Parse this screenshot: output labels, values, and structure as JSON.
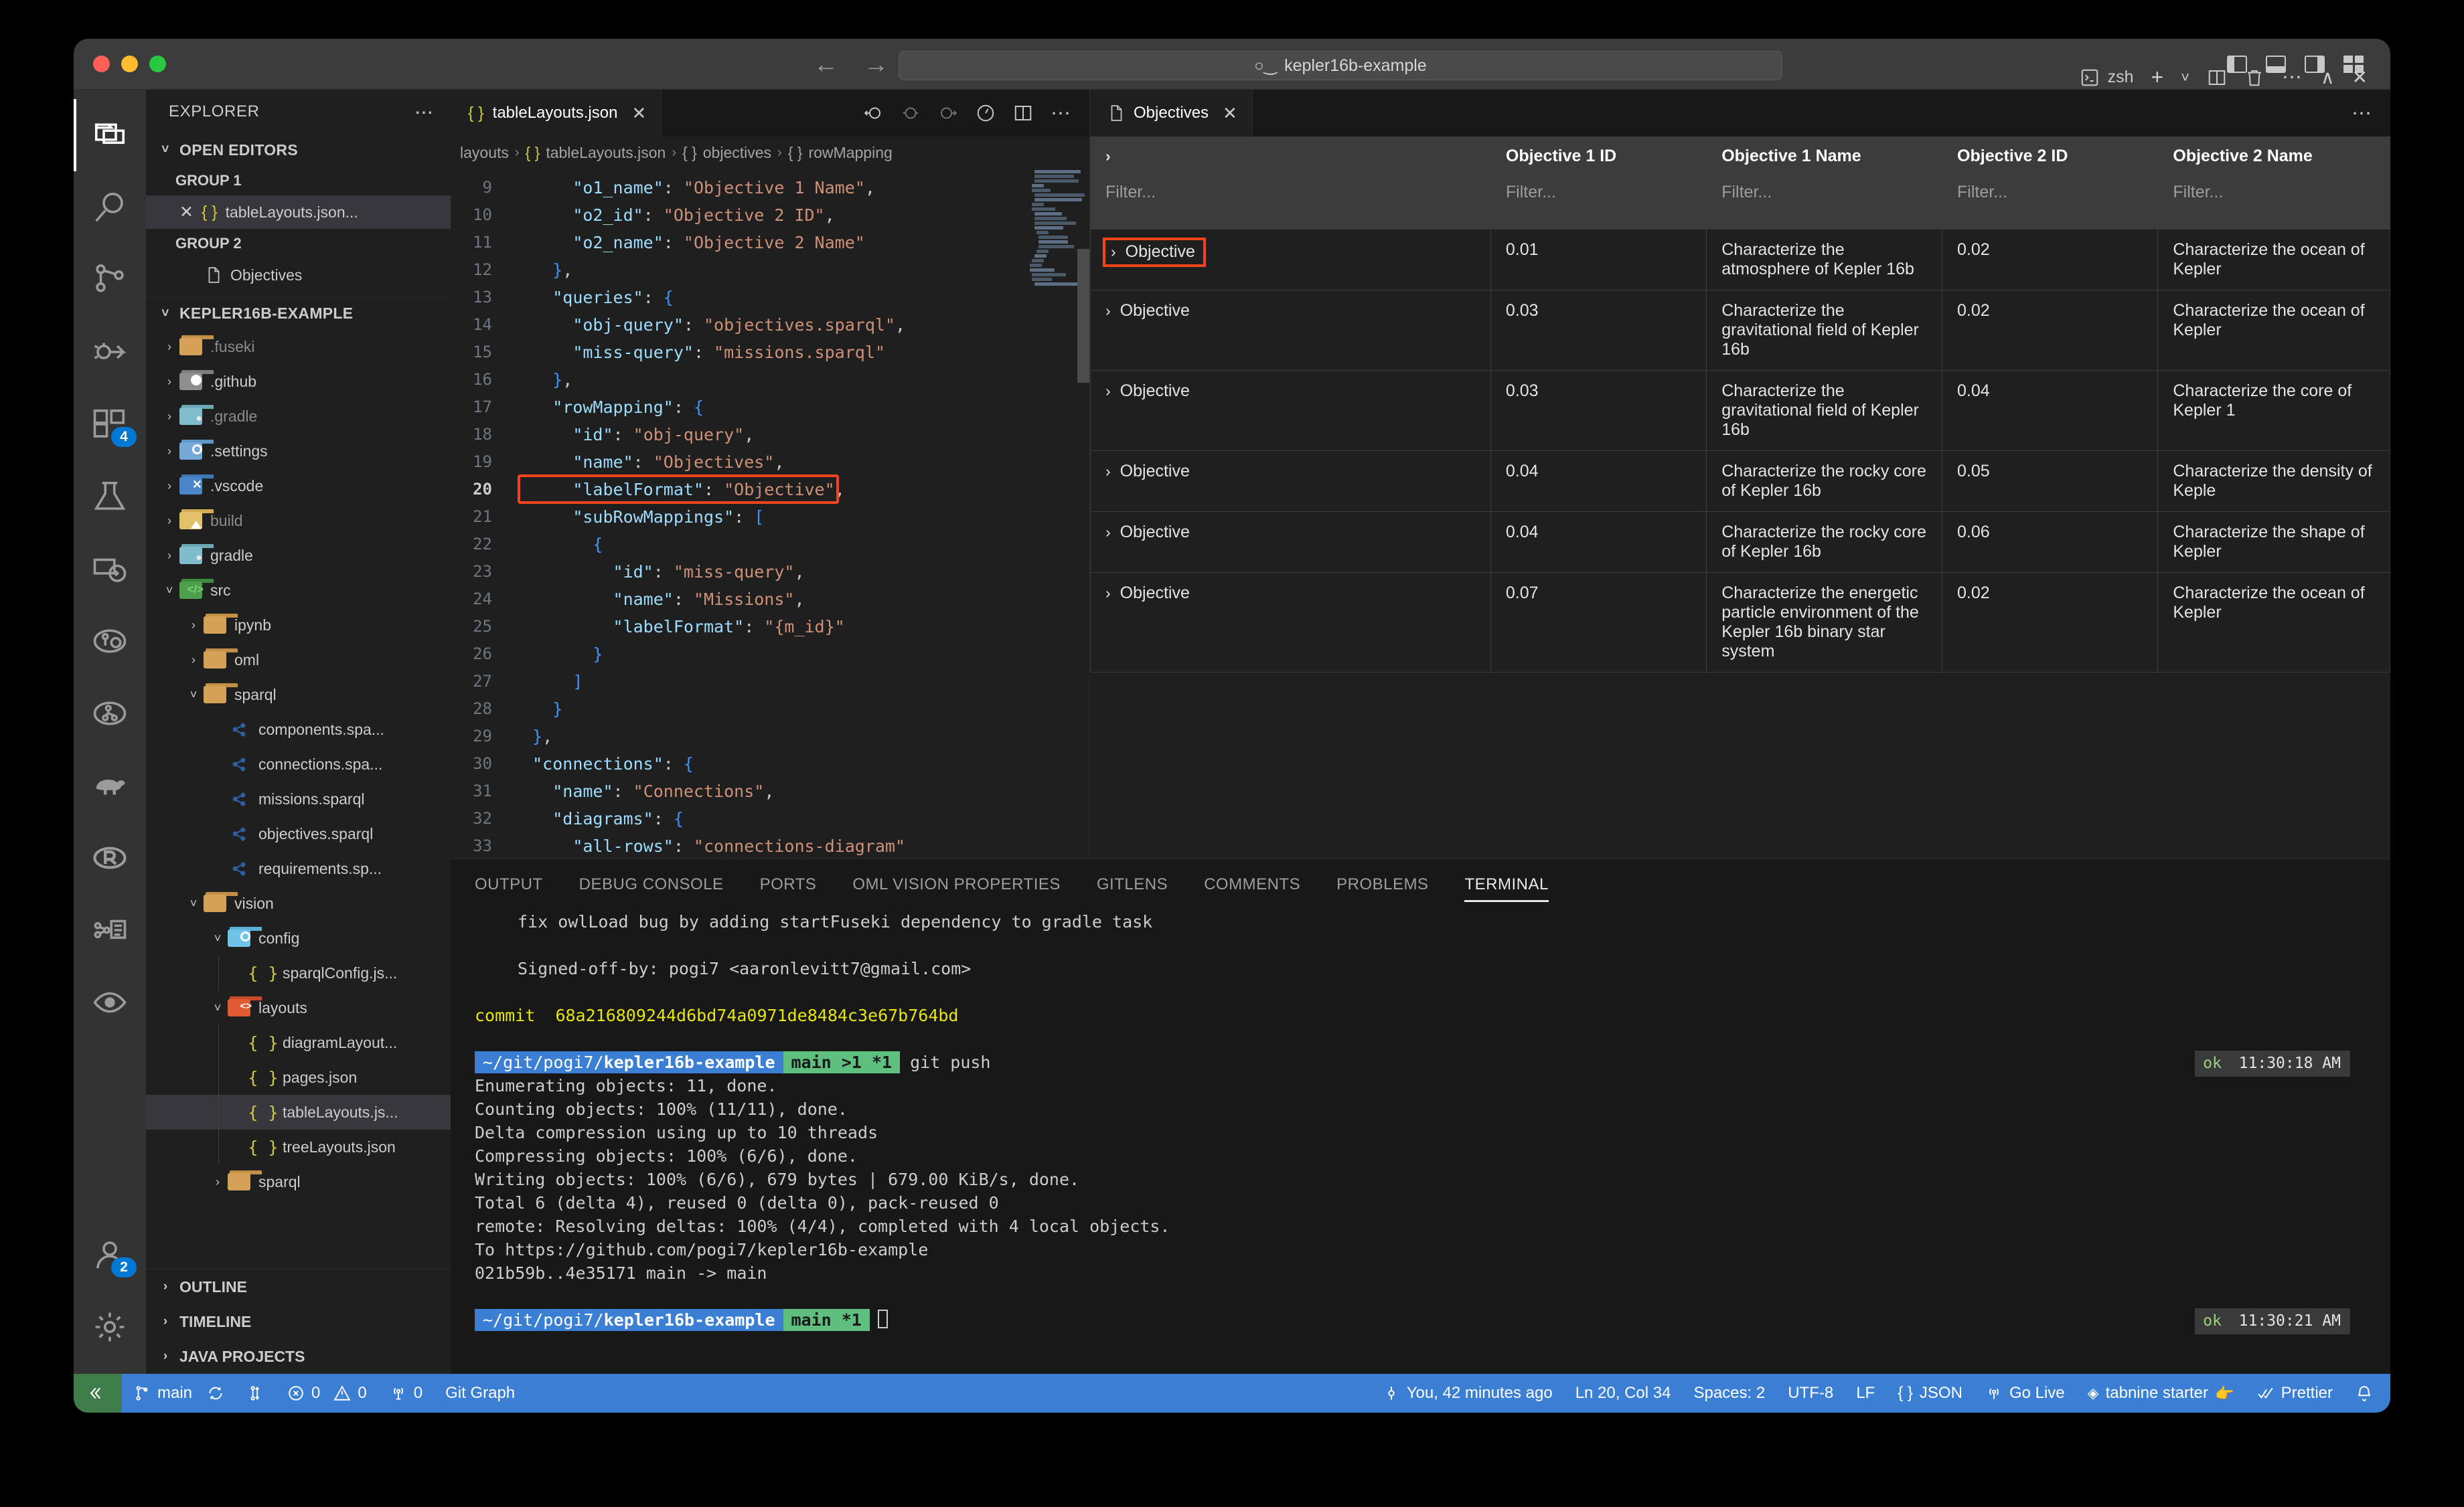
{
  "window": {
    "title_search": "kepler16b-example",
    "search_icon": "search-icon",
    "back_icon": "back-arrow-icon",
    "forward_icon": "forward-arrow-icon"
  },
  "activitybar": {
    "items": [
      {
        "name": "explorer",
        "icon": "files-icon",
        "active": true,
        "badge": ""
      },
      {
        "name": "search",
        "icon": "search-icon",
        "active": false,
        "badge": ""
      },
      {
        "name": "source-control",
        "icon": "source-control-icon",
        "active": false,
        "badge": ""
      },
      {
        "name": "run-and-debug",
        "icon": "debug-icon",
        "active": false,
        "badge": ""
      },
      {
        "name": "extensions",
        "icon": "extensions-icon",
        "active": false,
        "badge": "4"
      },
      {
        "name": "testing",
        "icon": "beaker-icon",
        "active": false,
        "badge": ""
      },
      {
        "name": "remote-explorer",
        "icon": "remote-icon",
        "active": false,
        "badge": ""
      },
      {
        "name": "oml-vision",
        "icon": "oml-vision-icon",
        "active": false,
        "badge": ""
      },
      {
        "name": "oml-graph",
        "icon": "oml-graph-icon",
        "active": false,
        "badge": ""
      },
      {
        "name": "gradle",
        "icon": "gradle-elephant-icon",
        "active": false,
        "badge": ""
      },
      {
        "name": "r-extension",
        "icon": "r-icon",
        "active": false,
        "badge": ""
      },
      {
        "name": "share",
        "icon": "share-icon",
        "active": false,
        "badge": ""
      },
      {
        "name": "watch",
        "icon": "eye-icon",
        "active": false,
        "badge": ""
      }
    ],
    "bottom": [
      {
        "name": "accounts",
        "icon": "account-icon",
        "badge": "2"
      },
      {
        "name": "manage-settings",
        "icon": "gear-icon",
        "badge": ""
      }
    ]
  },
  "sidebar": {
    "header": "EXPLORER",
    "more_icon": "ellipsis-icon",
    "open_editors": {
      "label": "OPEN EDITORS",
      "groups": [
        {
          "label": "GROUP 1",
          "items": [
            {
              "label": "tableLayouts.json...",
              "icon": "json-icon",
              "selected": true,
              "close_icon": "close-icon"
            }
          ]
        },
        {
          "label": "GROUP 2",
          "items": [
            {
              "label": "Objectives",
              "icon": "file-icon",
              "selected": false,
              "close_icon": ""
            }
          ]
        }
      ]
    },
    "project": {
      "label": "KEPLER16B-EXAMPLE",
      "tree": [
        {
          "label": ".fuseki",
          "depth": 1,
          "arrow": "right",
          "icon": "folder-tan",
          "dim": true,
          "selected": false
        },
        {
          "label": ".github",
          "depth": 1,
          "arrow": "right",
          "icon": "folder-github",
          "dim": false,
          "selected": false
        },
        {
          "label": ".gradle",
          "depth": 1,
          "arrow": "right",
          "icon": "folder-gradle",
          "dim": true,
          "selected": false
        },
        {
          "label": ".settings",
          "depth": 1,
          "arrow": "right",
          "icon": "folder-settings",
          "dim": false,
          "selected": false
        },
        {
          "label": ".vscode",
          "depth": 1,
          "arrow": "right",
          "icon": "folder-vscode",
          "dim": false,
          "selected": false
        },
        {
          "label": "build",
          "depth": 1,
          "arrow": "right",
          "icon": "folder-build",
          "dim": true,
          "selected": false
        },
        {
          "label": "gradle",
          "depth": 1,
          "arrow": "right",
          "icon": "folder-gradle",
          "dim": false,
          "selected": false
        },
        {
          "label": "src",
          "depth": 1,
          "arrow": "down",
          "icon": "folder-src",
          "dim": false,
          "selected": false
        },
        {
          "label": "ipynb",
          "depth": 2,
          "arrow": "right",
          "icon": "folder-tan",
          "dim": false,
          "selected": false
        },
        {
          "label": "oml",
          "depth": 2,
          "arrow": "right",
          "icon": "folder-tan",
          "dim": false,
          "selected": false
        },
        {
          "label": "sparql",
          "depth": 2,
          "arrow": "down",
          "icon": "folder-tan",
          "dim": false,
          "selected": false
        },
        {
          "label": "components.spa...",
          "depth": 3,
          "arrow": "none",
          "icon": "sparql-icon",
          "dim": false,
          "selected": false
        },
        {
          "label": "connections.spa...",
          "depth": 3,
          "arrow": "none",
          "icon": "sparql-icon",
          "dim": false,
          "selected": false
        },
        {
          "label": "missions.sparql",
          "depth": 3,
          "arrow": "none",
          "icon": "sparql-icon",
          "dim": false,
          "selected": false
        },
        {
          "label": "objectives.sparql",
          "depth": 3,
          "arrow": "none",
          "icon": "sparql-icon",
          "dim": false,
          "selected": false
        },
        {
          "label": "requirements.sp...",
          "depth": 3,
          "arrow": "none",
          "icon": "sparql-icon",
          "dim": false,
          "selected": false
        },
        {
          "label": "vision",
          "depth": 2,
          "arrow": "down",
          "icon": "folder-tan",
          "dim": false,
          "selected": false
        },
        {
          "label": "config",
          "depth": 3,
          "arrow": "down",
          "icon": "folder-config",
          "dim": false,
          "selected": false
        },
        {
          "label": "sparqlConfig.js...",
          "depth": 4,
          "arrow": "none",
          "icon": "json-icon",
          "dim": false,
          "selected": false
        },
        {
          "label": "layouts",
          "depth": 3,
          "arrow": "down",
          "icon": "folder-layouts",
          "dim": false,
          "selected": false
        },
        {
          "label": "diagramLayout...",
          "depth": 4,
          "arrow": "none",
          "icon": "json-icon",
          "dim": false,
          "selected": false
        },
        {
          "label": "pages.json",
          "depth": 4,
          "arrow": "none",
          "icon": "json-icon",
          "dim": false,
          "selected": false
        },
        {
          "label": "tableLayouts.js...",
          "depth": 4,
          "arrow": "none",
          "icon": "json-icon",
          "dim": false,
          "selected": true
        },
        {
          "label": "treeLayouts.json",
          "depth": 4,
          "arrow": "none",
          "icon": "json-icon",
          "dim": false,
          "selected": false
        },
        {
          "label": "sparql",
          "depth": 3,
          "arrow": "right",
          "icon": "folder-tan",
          "dim": false,
          "selected": false
        }
      ]
    },
    "footer": [
      "OUTLINE",
      "TIMELINE",
      "JAVA PROJECTS"
    ]
  },
  "editor": {
    "tab": {
      "label": "tableLayouts.json",
      "icon": "json-icon",
      "close_icon": "close-icon"
    },
    "actions": [
      "go-back-icon",
      "sync-icon",
      "go-forward-icon",
      "preview-icon",
      "split-editor-icon",
      "more-actions-icon"
    ],
    "breadcrumbs": [
      "layouts",
      "tableLayouts.json",
      "objectives",
      "rowMapping"
    ],
    "lines": [
      {
        "n": 9,
        "text": "      \"o1_name\": \"Objective 1 Name\","
      },
      {
        "n": 10,
        "text": "      \"o2_id\": \"Objective 2 ID\","
      },
      {
        "n": 11,
        "text": "      \"o2_name\": \"Objective 2 Name\""
      },
      {
        "n": 12,
        "text": "    },"
      },
      {
        "n": 13,
        "text": "    \"queries\": {"
      },
      {
        "n": 14,
        "text": "      \"obj-query\": \"objectives.sparql\","
      },
      {
        "n": 15,
        "text": "      \"miss-query\": \"missions.sparql\""
      },
      {
        "n": 16,
        "text": "    },"
      },
      {
        "n": 17,
        "text": "    \"rowMapping\": {"
      },
      {
        "n": 18,
        "text": "      \"id\": \"obj-query\","
      },
      {
        "n": 19,
        "text": "      \"name\": \"Objectives\","
      },
      {
        "n": 20,
        "text": "      \"labelFormat\": \"Objective\","
      },
      {
        "n": 21,
        "text": "      \"subRowMappings\": ["
      },
      {
        "n": 22,
        "text": "        {"
      },
      {
        "n": 23,
        "text": "          \"id\": \"miss-query\","
      },
      {
        "n": 24,
        "text": "          \"name\": \"Missions\","
      },
      {
        "n": 25,
        "text": "          \"labelFormat\": \"{m_id}\""
      },
      {
        "n": 26,
        "text": "        }"
      },
      {
        "n": 27,
        "text": "      ]"
      },
      {
        "n": 28,
        "text": "    }"
      },
      {
        "n": 29,
        "text": "  },"
      },
      {
        "n": 30,
        "text": "  \"connections\": {"
      },
      {
        "n": 31,
        "text": "    \"name\": \"Connections\","
      },
      {
        "n": 32,
        "text": "    \"diagrams\": {"
      },
      {
        "n": 33,
        "text": "      \"all-rows\": \"connections-diagram\""
      }
    ],
    "current_line": 20,
    "highlight_color": "#f4441e"
  },
  "table_panel": {
    "tab": {
      "label": "Objectives",
      "icon": "file-icon",
      "close_icon": "close-icon"
    },
    "more_icon": "ellipsis-icon",
    "columns": [
      "",
      "Objective 1 ID",
      "Objective 1 Name",
      "Objective 2 ID",
      "Objective 2 Name"
    ],
    "filter_placeholder": "Filter...",
    "expander_icon": "chevron-right-icon",
    "rows": [
      {
        "label": "Objective",
        "highlighted": true,
        "o1_id": "0.01",
        "o1_name": "Characterize the atmosphere of Kepler 16b",
        "o2_id": "0.02",
        "o2_name": "Characterize the ocean of Kepler"
      },
      {
        "label": "Objective",
        "highlighted": false,
        "o1_id": "0.03",
        "o1_name": "Characterize the gravitational field of Kepler 16b",
        "o2_id": "0.02",
        "o2_name": "Characterize the ocean of Kepler"
      },
      {
        "label": "Objective",
        "highlighted": false,
        "o1_id": "0.03",
        "o1_name": "Characterize the gravitational field of Kepler 16b",
        "o2_id": "0.04",
        "o2_name": "Characterize the core of Kepler 1"
      },
      {
        "label": "Objective",
        "highlighted": false,
        "o1_id": "0.04",
        "o1_name": "Characterize the rocky core of Kepler 16b",
        "o2_id": "0.05",
        "o2_name": "Characterize the density of Keple"
      },
      {
        "label": "Objective",
        "highlighted": false,
        "o1_id": "0.04",
        "o1_name": "Characterize the rocky core of Kepler 16b",
        "o2_id": "0.06",
        "o2_name": "Characterize the shape of Kepler"
      },
      {
        "label": "Objective",
        "highlighted": false,
        "o1_id": "0.07",
        "o1_name": "Characterize the energetic particle environment of the Kepler 16b binary star system",
        "o2_id": "0.02",
        "o2_name": "Characterize the ocean of Kepler"
      }
    ]
  },
  "panel": {
    "tabs": [
      "OUTPUT",
      "DEBUG CONSOLE",
      "PORTS",
      "OML VISION PROPERTIES",
      "GITLENS",
      "COMMENTS",
      "PROBLEMS",
      "TERMINAL"
    ],
    "active_tab": "TERMINAL",
    "shell_label": "zsh",
    "actions": [
      "terminal-icon",
      "new-terminal-icon",
      "chevron-down-icon",
      "split-terminal-icon",
      "kill-terminal-icon",
      "more-actions-icon",
      "maximize-panel-icon",
      "close-panel-icon"
    ],
    "terminal": {
      "line_commit_msg": "fix owlLoad bug by adding startFuseki dependency to gradle task",
      "line_signoff": "Signed-off-by: pogi7 <aaronlevitt7@gmail.com>",
      "commit_label": "commit",
      "commit_hash": "68a216809244d6bd74a0971de8484c3e67b764bd",
      "prompt1_path": "~/git/pogi7/kepler16b-example",
      "prompt1_branch": "main >1 *1",
      "prompt1_cmd": "git push",
      "prompt1_ok": "ok",
      "prompt1_time": "11:30:18 AM",
      "output": [
        "Enumerating objects: 11, done.",
        "Counting objects: 100% (11/11), done.",
        "Delta compression using up to 10 threads",
        "Compressing objects: 100% (6/6), done.",
        "Writing objects: 100% (6/6), 679 bytes | 679.00 KiB/s, done.",
        "Total 6 (delta 4), reused 0 (delta 0), pack-reused 0",
        "remote: Resolving deltas: 100% (4/4), completed with 4 local objects.",
        "To https://github.com/pogi7/kepler16b-example",
        "   021b59b..4e35171  main -> main"
      ],
      "prompt2_path": "~/git/pogi7/kepler16b-example",
      "prompt2_branch": "main *1",
      "prompt2_ok": "ok",
      "prompt2_time": "11:30:21 AM"
    }
  },
  "statusbar": {
    "remote_icon": "remote-window-icon",
    "branch": "main",
    "branch_icon": "git-branch-icon",
    "sync_icon": "sync-icon",
    "stash_icon": "git-stash-icon",
    "errors": "0",
    "warnings": "0",
    "ports": "0",
    "git_graph": "Git Graph",
    "blame": "You, 42 minutes ago",
    "blame_icon": "git-commit-icon",
    "position": "Ln 20, Col 34",
    "indentation": "Spaces: 2",
    "encoding": "UTF-8",
    "eol": "LF",
    "language": "JSON",
    "language_icon": "json-icon",
    "go_live": "Go Live",
    "go_live_icon": "broadcast-icon",
    "tabnine": "tabnine starter",
    "tabnine_icon": "tabnine-icon",
    "tabnine_emoji": "👉",
    "prettier": "Prettier",
    "prettier_icon": "checkmarks-icon",
    "bell_icon": "bell-icon"
  }
}
